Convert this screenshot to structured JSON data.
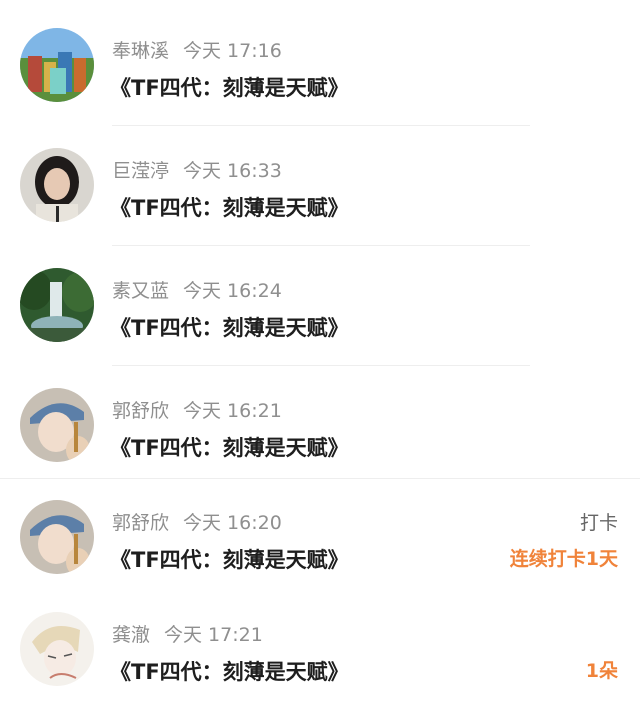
{
  "items": [
    {
      "name": "奉琳溪",
      "time": "今天 17:16",
      "message": "《TF四代：刻薄是天赋》",
      "avatar": "game-scene-avatar"
    },
    {
      "name": "巨滢渟",
      "time": "今天 16:33",
      "message": "《TF四代：刻薄是天赋》",
      "avatar": "girl-portrait-avatar"
    },
    {
      "name": "素又蓝",
      "time": "今天 16:24",
      "message": "《TF四代：刻薄是天赋》",
      "avatar": "waterfall-avatar"
    },
    {
      "name": "郭舒欣",
      "time": "今天 16:21",
      "message": "《TF四代：刻薄是天赋》",
      "avatar": "cap-portrait-avatar"
    },
    {
      "name": "郭舒欣",
      "time": "今天 16:20",
      "message": "《TF四代：刻薄是天赋》",
      "avatar": "cap-portrait-avatar",
      "right_top": "打卡",
      "right_bottom": "连续打卡1天"
    },
    {
      "name": "龚澈",
      "time": "今天 17:21",
      "message": "《TF四代：刻薄是天赋》",
      "avatar": "sketch-portrait-avatar",
      "right_bottom": "1朵"
    }
  ],
  "colors": {
    "accent": "#f0833a",
    "name_text": "#8f8f8f",
    "message_text": "#1e1e1e"
  }
}
